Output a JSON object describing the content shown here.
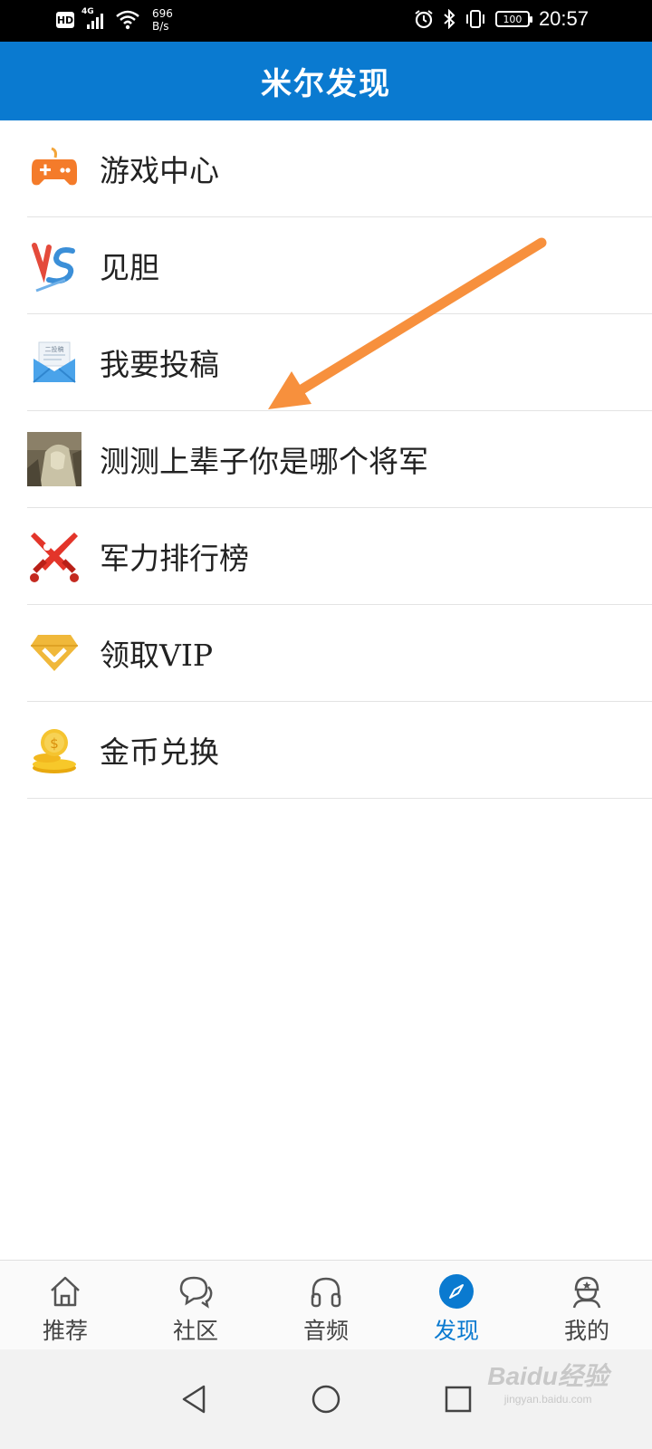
{
  "status_bar": {
    "hd": "HD",
    "network": "4G",
    "speed_value": "696",
    "speed_unit": "B/s",
    "battery": "100",
    "time": "20:57"
  },
  "header": {
    "title": "米尔发现"
  },
  "menu": {
    "items": [
      {
        "label": "游戏中心",
        "icon": "gamepad-icon"
      },
      {
        "label": "见胆",
        "icon": "vs-logo-icon"
      },
      {
        "label": "我要投稿",
        "icon": "submission-envelope-icon"
      },
      {
        "label": "测测上辈子你是哪个将军",
        "icon": "general-thumbnail-image"
      },
      {
        "label": "军力排行榜",
        "icon": "crossed-swords-icon"
      },
      {
        "label": "领取VIP",
        "icon": "vip-diamond-icon"
      },
      {
        "label": "金币兑换",
        "icon": "gold-coins-icon"
      }
    ]
  },
  "envelope_tag": "二投稿",
  "bottom_nav": {
    "tabs": [
      {
        "label": "推荐",
        "icon": "home-icon",
        "active": false
      },
      {
        "label": "社区",
        "icon": "chat-bubbles-icon",
        "active": false
      },
      {
        "label": "音频",
        "icon": "headphones-icon",
        "active": false
      },
      {
        "label": "发现",
        "icon": "compass-icon",
        "active": true
      },
      {
        "label": "我的",
        "icon": "soldier-avatar-icon",
        "active": false
      }
    ]
  },
  "watermark": {
    "main": "Baidu经验",
    "sub": "jingyan.baidu.com"
  },
  "colors": {
    "header_bg": "#0a7ad0",
    "active_tab": "#0a7ad0",
    "annotation_arrow": "#f7903d"
  }
}
